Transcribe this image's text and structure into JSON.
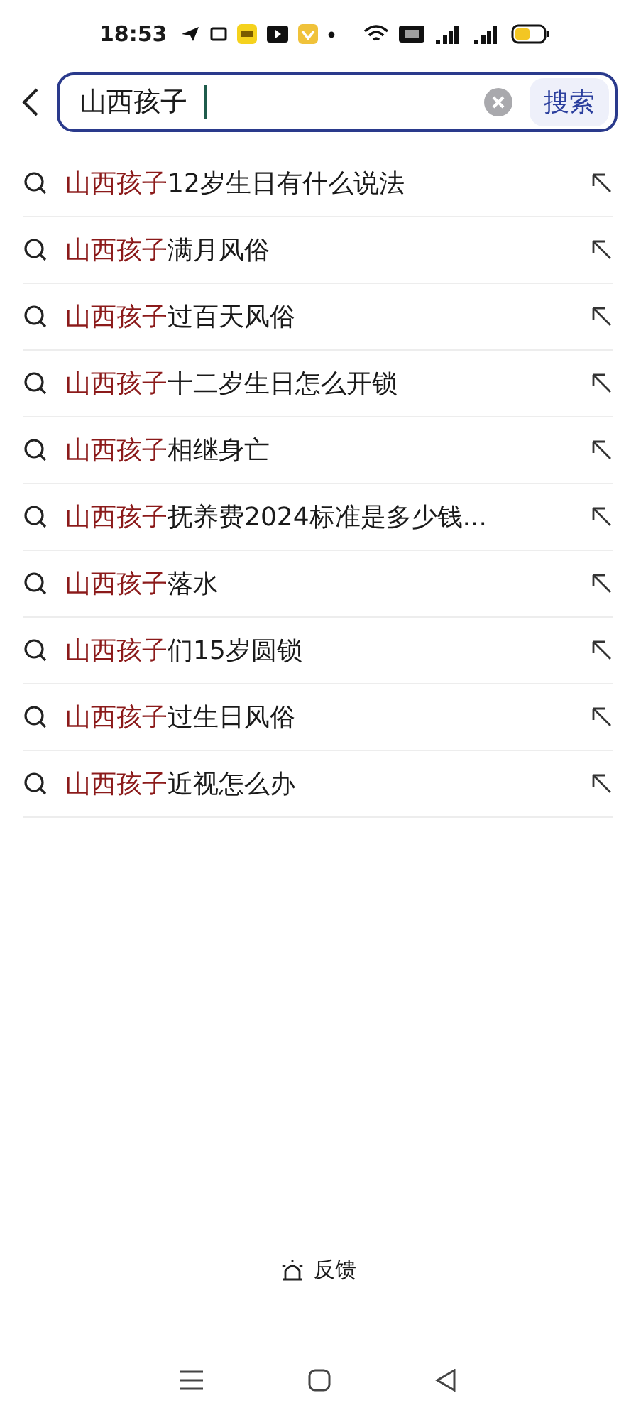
{
  "status_bar": {
    "time": "18:53"
  },
  "search": {
    "value": "山西孩子",
    "button": "搜索"
  },
  "suggestions": [
    {
      "match": "山西孩子",
      "rest": "12岁生日有什么说法"
    },
    {
      "match": "山西孩子",
      "rest": "满月风俗"
    },
    {
      "match": "山西孩子",
      "rest": "过百天风俗"
    },
    {
      "match": "山西孩子",
      "rest": "十二岁生日怎么开锁"
    },
    {
      "match": "山西孩子",
      "rest": "相继身亡"
    },
    {
      "match": "山西孩子",
      "rest": "抚养费2024标准是多少钱..."
    },
    {
      "match": "山西孩子",
      "rest": "落水"
    },
    {
      "match": "山西孩子",
      "rest": "们15岁圆锁"
    },
    {
      "match": "山西孩子",
      "rest": "过生日风俗"
    },
    {
      "match": "山西孩子",
      "rest": "近视怎么办"
    }
  ],
  "feedback": "反馈"
}
